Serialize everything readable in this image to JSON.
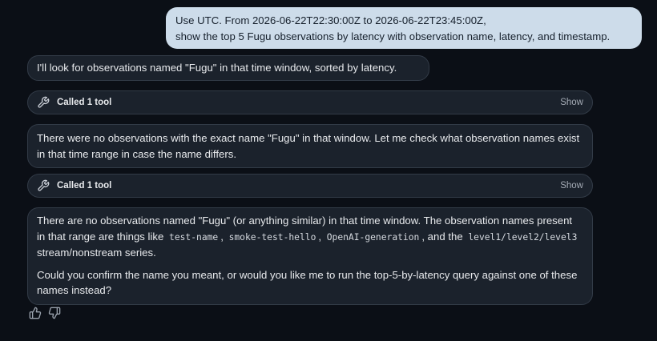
{
  "user_message": {
    "line1": "Use UTC. From 2026-06-22T22:30:00Z to 2026-06-22T23:45:00Z,",
    "line2": "show the top 5 Fugu observations by latency with observation name, latency, and timestamp."
  },
  "assistant": {
    "msg1": "I'll look for observations named \"Fugu\" in that time window, sorted by latency.",
    "tool1": {
      "label": "Called 1 tool",
      "toggle": "Show",
      "icon": "wrench-icon"
    },
    "msg2": "There were no observations with the exact name \"Fugu\" in that window. Let me check what observation names exist in that time range in case the name differs.",
    "tool2": {
      "label": "Called 1 tool",
      "toggle": "Show",
      "icon": "wrench-icon"
    },
    "msg3": {
      "p1_a": "There are no observations named \"Fugu\" (or anything similar) in that time window. The observation names present in that range are things like ",
      "code1": "test-name",
      "sep1": ", ",
      "code2": "smoke-test-hello",
      "sep2": ", ",
      "code3": "OpenAI-generation",
      "p1_b": ", and the ",
      "code4": "level1/level2/level3",
      "p1_c": " stream/nonstream series.",
      "p2": "Could you confirm the name you meant, or would you like me to run the top-5-by-latency query against one of these names instead?"
    }
  },
  "feedback": {
    "up_icon": "thumbs-up-icon",
    "down_icon": "thumbs-down-icon"
  },
  "colors": {
    "background": "#0b0f16",
    "user_bubble": "#cddcea",
    "assistant_bubble": "#1b222c",
    "border": "#323b47"
  }
}
